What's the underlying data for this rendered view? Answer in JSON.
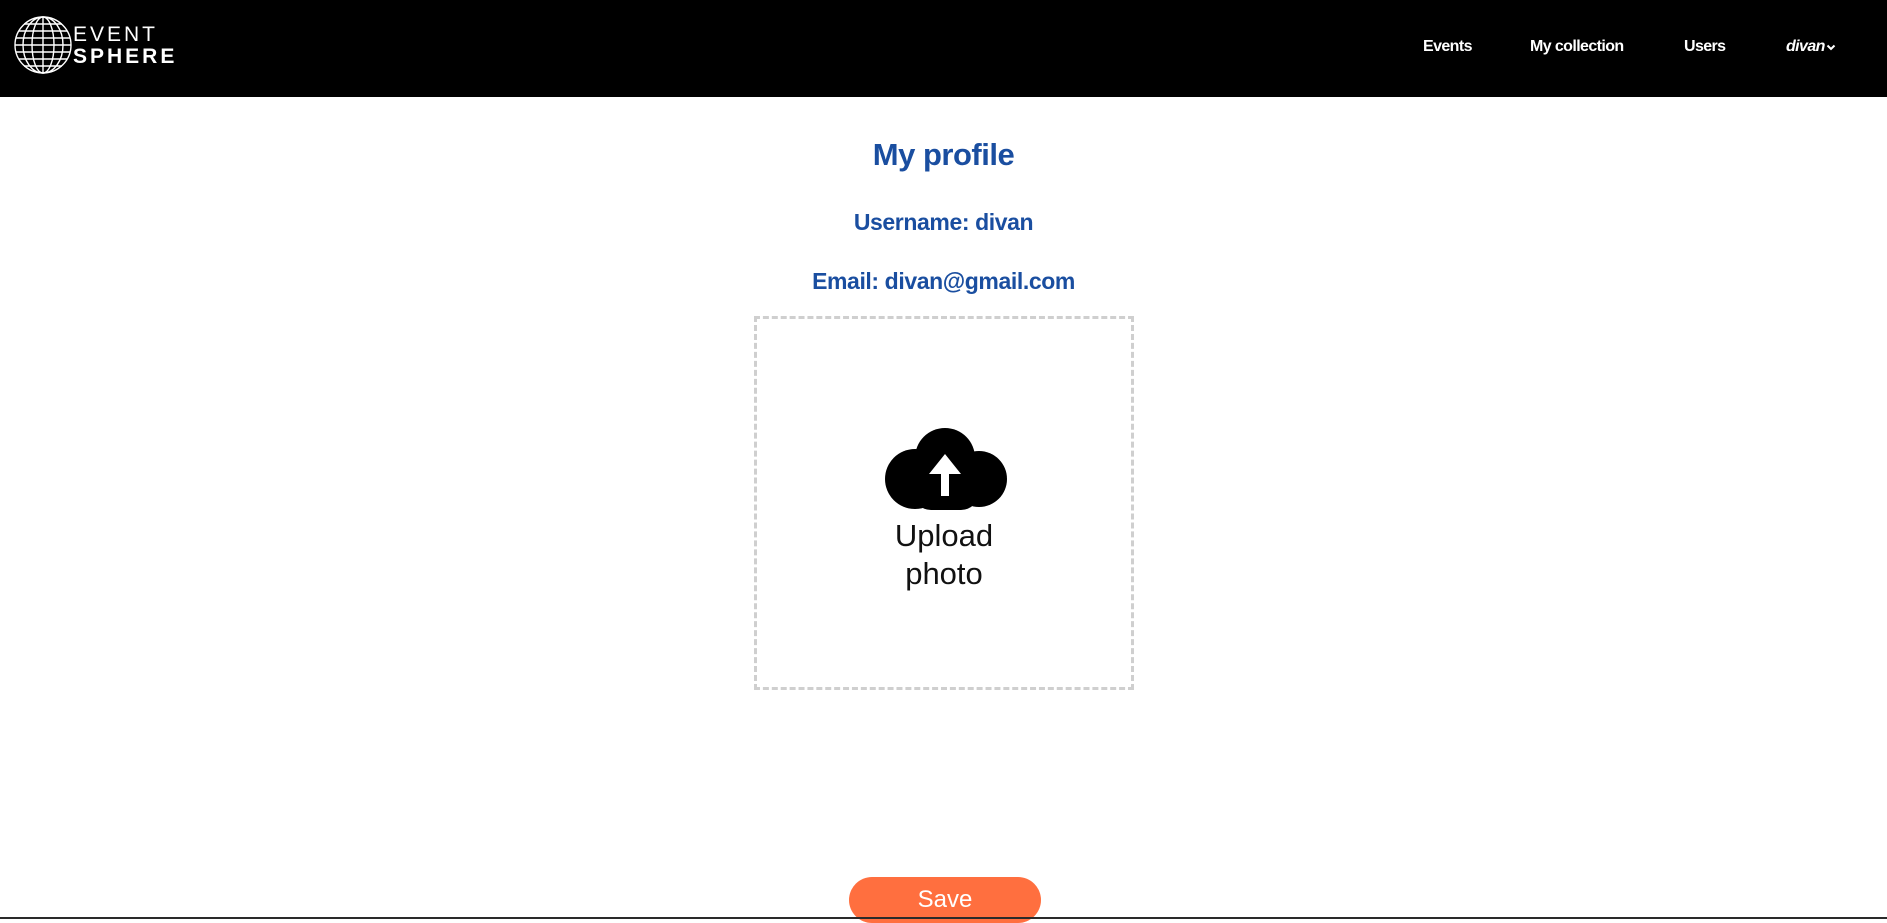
{
  "navbar": {
    "logo": {
      "line1": "EVENT",
      "line2": "SPHERE"
    },
    "links": {
      "events": "Events",
      "my_collection": "My collection",
      "users": "Users"
    },
    "user_menu": {
      "label": "divan",
      "icon": "chevron-down-icon"
    }
  },
  "profile": {
    "title": "My profile",
    "username_line": "Username: divan",
    "email_line": "Email: divan@gmail.com",
    "upload": {
      "icon": "cloud-upload-icon",
      "line1": "Upload",
      "line2": "photo"
    },
    "save_label": "Save"
  },
  "colors": {
    "navbar_bg": "#000000",
    "heading": "#1a4ea0",
    "save_button": "#ff6f3f",
    "upload_border": "#cfcfcf"
  }
}
